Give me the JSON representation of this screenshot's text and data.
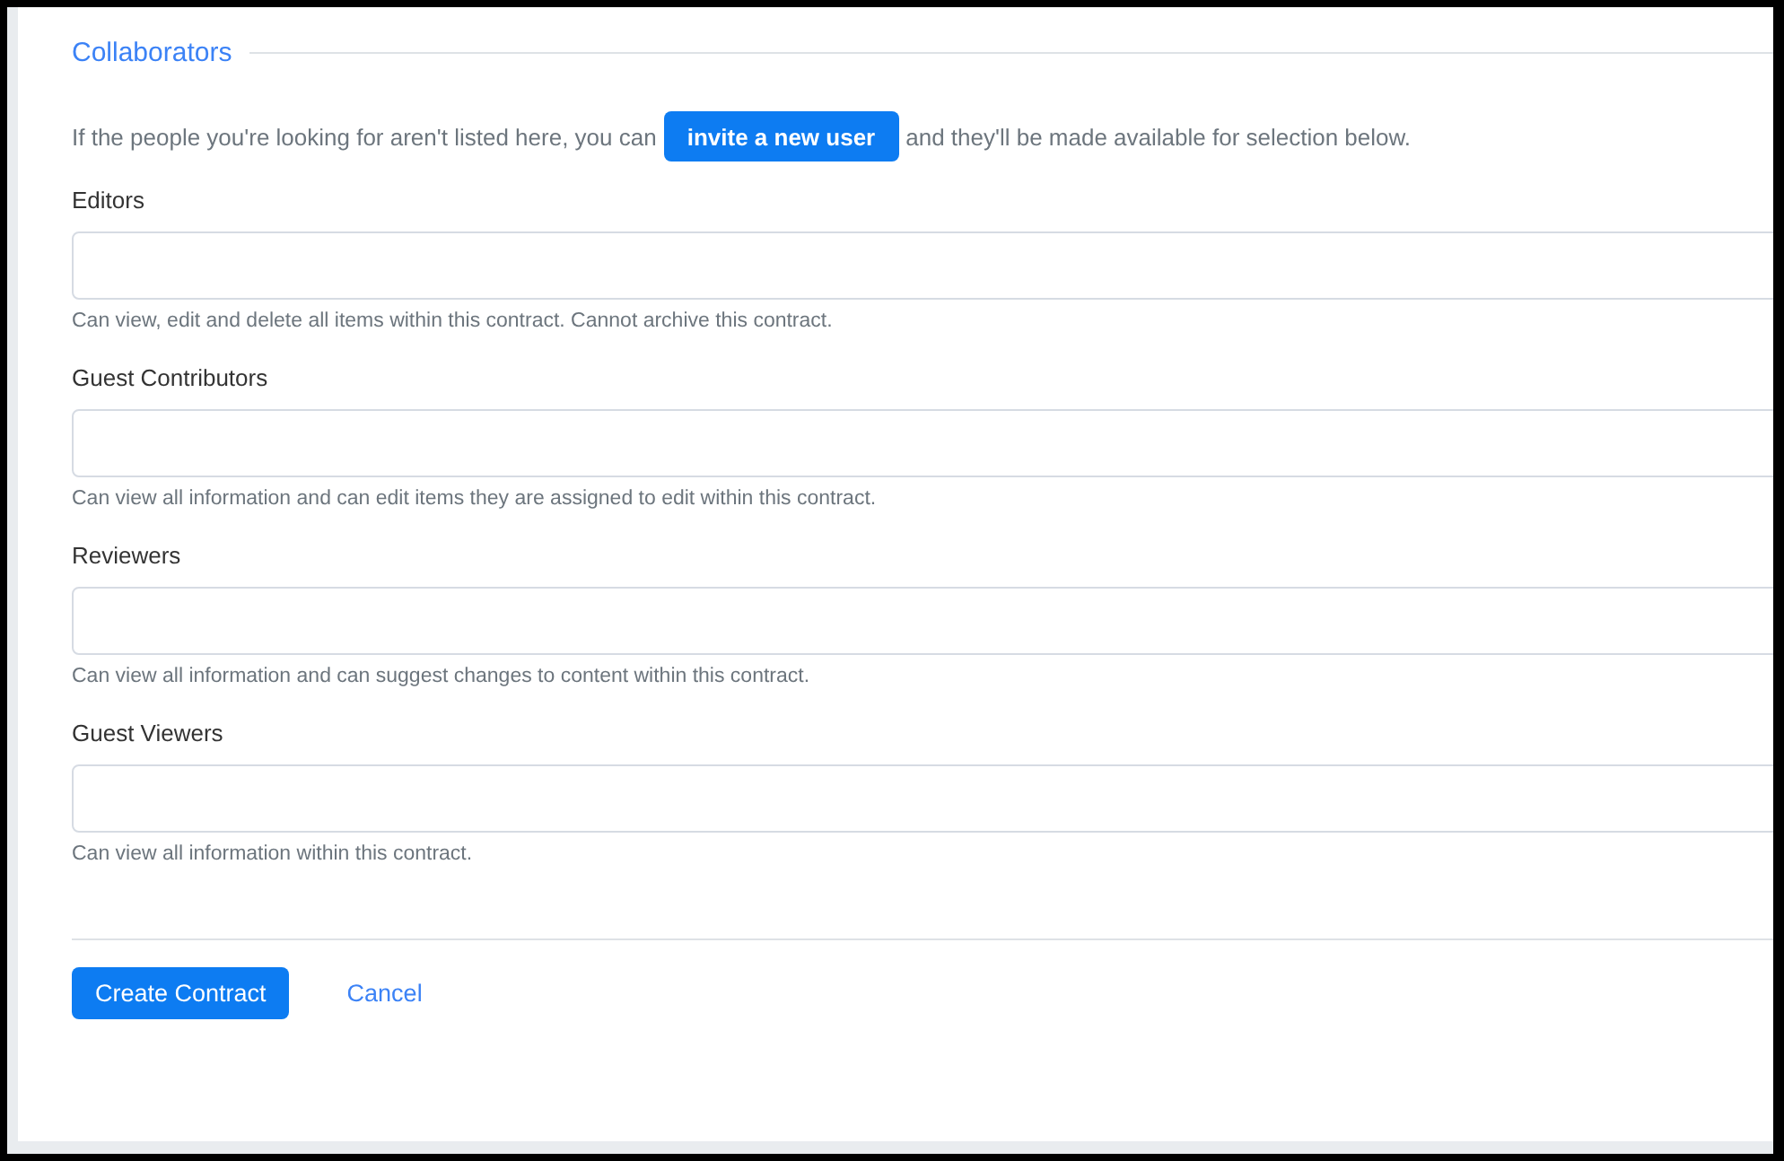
{
  "section_title": "Collaborators",
  "intro": {
    "before": "If the people you're looking for aren't listed here, you can",
    "button": "invite a new user",
    "after": "and they'll be made available for selection below."
  },
  "fields": [
    {
      "label": "Editors",
      "help": "Can view, edit and delete all items within this contract. Cannot archive this contract."
    },
    {
      "label": "Guest Contributors",
      "help": "Can view all information and can edit items they are assigned to edit within this contract."
    },
    {
      "label": "Reviewers",
      "help": "Can view all information and can suggest changes to content within this contract."
    },
    {
      "label": "Guest Viewers",
      "help": "Can view all information within this contract."
    }
  ],
  "buttons": {
    "primary": "Create Contract",
    "cancel": "Cancel"
  }
}
